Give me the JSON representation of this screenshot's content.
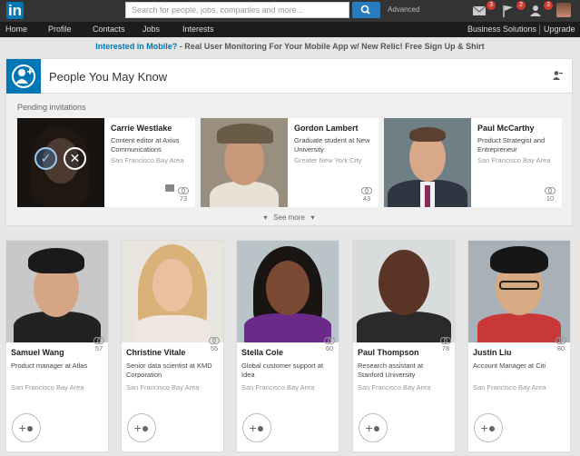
{
  "topbar": {
    "logo_text": "in",
    "search_placeholder": "Search for people, jobs, companies and more...",
    "advanced_label": "Advanced",
    "badges": {
      "messages": "3",
      "notifications": "2",
      "invitations": "3"
    }
  },
  "nav": {
    "items": [
      "Home",
      "Profile",
      "Contacts",
      "Jobs",
      "Interests"
    ],
    "business": "Business Solutions",
    "upgrade": "Upgrade"
  },
  "promo": {
    "link": "Interested in Mobile?",
    "text": " - Real User Monitoring For Your Mobile App w/ New Relic! Free Sign Up & Shirt"
  },
  "pymk": {
    "title": "People You May Know",
    "pending_label": "Pending invitations",
    "see_more": "See more",
    "invitations": [
      {
        "name": "Carrie Westlake",
        "title": "Content editor at Axius Communications",
        "location": "San Francisco Bay Area",
        "connections": "73"
      },
      {
        "name": "Gordon Lambert",
        "title": "Graduate student at New University",
        "location": "Greater New York City",
        "connections": "43"
      },
      {
        "name": "Paul McCarthy",
        "title": "Product Strategist and Entrepreneur",
        "location": "San Francisco Bay Area",
        "connections": "10"
      }
    ]
  },
  "suggestions": [
    {
      "name": "Samuel Wang",
      "title": "Product manager at Atlas",
      "location": "San Francisco Bay Area",
      "connections": "57"
    },
    {
      "name": "Christine Vitale",
      "title": "Senior data scientist at KMD Corporation",
      "location": "San Francisco Bay Area",
      "connections": "55"
    },
    {
      "name": "Stella Cole",
      "title": "Global customer support at Idea",
      "location": "San Francisco Bay Area",
      "connections": "60"
    },
    {
      "name": "Paul Thompson",
      "title": "Research assistant at Stanford University",
      "location": "San Francisco Bay Area",
      "connections": "78"
    },
    {
      "name": "Justin Liu",
      "title": "Account Manager at Citi",
      "location": "San Francisco Bay Area",
      "connections": "80"
    }
  ],
  "colors": {
    "brand": "#0077b5",
    "topbar": "#333333",
    "badge": "#d03a2f"
  }
}
